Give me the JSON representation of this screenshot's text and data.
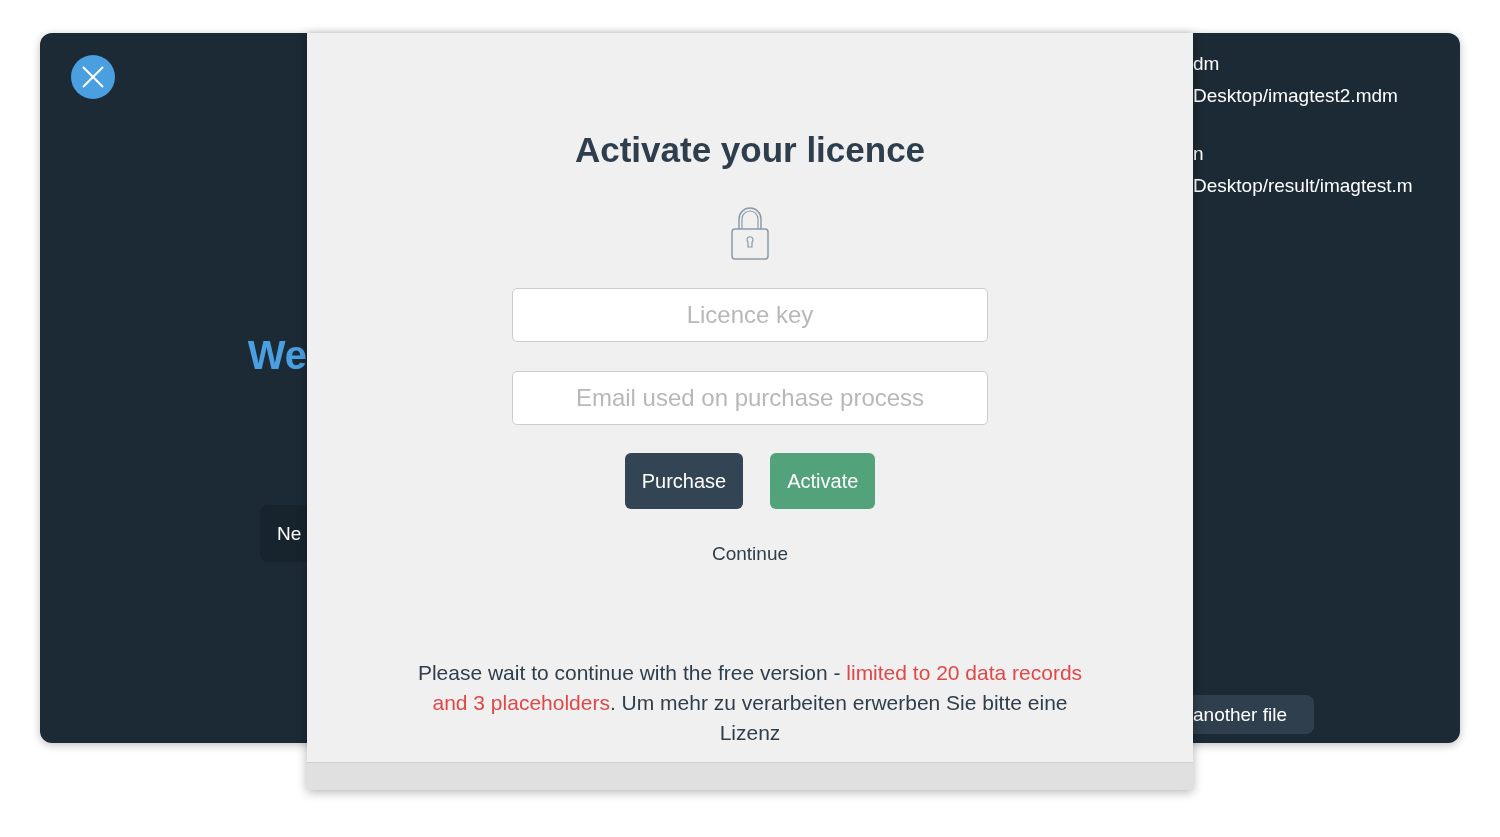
{
  "background": {
    "left": {
      "heading": "We",
      "button": "Ne"
    },
    "right": {
      "lines": [
        "dm",
        "Desktop/imagtest2.mdm",
        "n",
        "Desktop/result/imagtest.m"
      ],
      "button": "another file"
    }
  },
  "modal": {
    "title": "Activate your licence",
    "fields": [
      {
        "placeholder": "Licence key"
      },
      {
        "placeholder": "Email used on purchase process"
      }
    ],
    "buttons": [
      {
        "label": "Purchase",
        "kind": "secondary"
      },
      {
        "label": "Activate",
        "kind": "primary"
      }
    ],
    "link": "Continue",
    "notice": {
      "before": "Please wait to continue with the free version - ",
      "highlight": "limited to 20 data records and 3 placeholders",
      "after": ". Um mehr zu verarbeiten erwerben Sie bitte eine Lizenz"
    }
  }
}
